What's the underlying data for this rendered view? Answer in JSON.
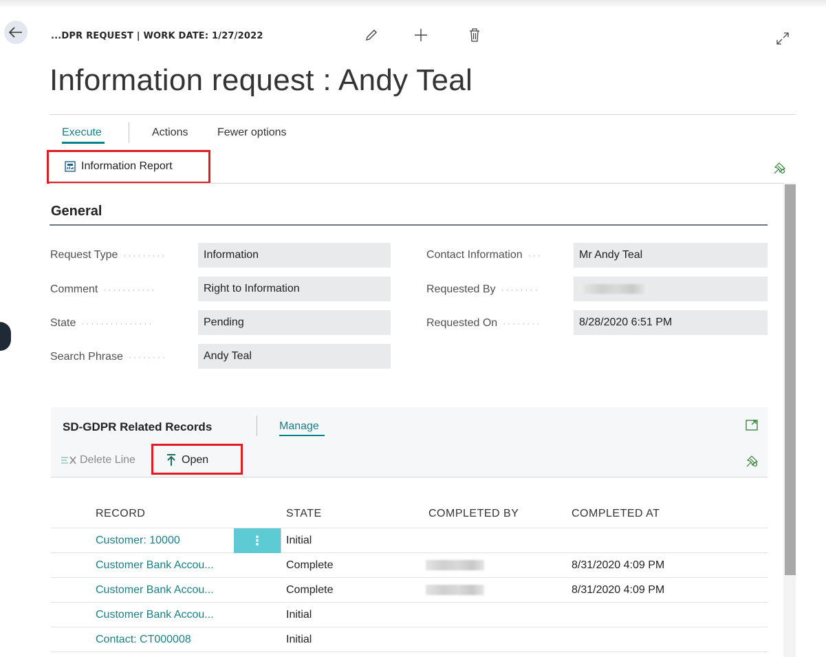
{
  "header": {
    "breadcrumb": "...DPR REQUEST | WORK DATE: 1/27/2022",
    "title": "Information request : Andy Teal"
  },
  "tabs": [
    {
      "label": "Execute",
      "active": true
    },
    {
      "label": "Actions"
    },
    {
      "label": "Fewer options"
    }
  ],
  "actions": {
    "information_report": "Information Report"
  },
  "general": {
    "section_title": "General",
    "left_fields": [
      {
        "label": "Request Type",
        "value": "Information"
      },
      {
        "label": "Comment",
        "value": "Right to Information"
      },
      {
        "label": "State",
        "value": "Pending"
      },
      {
        "label": "Search Phrase",
        "value": "Andy Teal"
      }
    ],
    "right_fields": [
      {
        "label": "Contact Information",
        "value": "Mr Andy Teal"
      },
      {
        "label": "Requested By",
        "value": ""
      },
      {
        "label": "Requested On",
        "value": "8/28/2020 6:51 PM"
      }
    ]
  },
  "related": {
    "title": "SD-GDPR Related Records",
    "manage": "Manage",
    "delete_line": "Delete Line",
    "open": "Open",
    "columns": [
      "RECORD",
      "STATE",
      "COMPLETED BY",
      "COMPLETED AT"
    ],
    "rows": [
      {
        "record": "Customer: 10000",
        "state": "Initial",
        "completed_by": "",
        "completed_at": ""
      },
      {
        "record": "Customer Bank Accou...",
        "state": "Complete",
        "completed_by": "",
        "completed_at": "8/31/2020 4:09 PM"
      },
      {
        "record": "Customer Bank Accou...",
        "state": "Complete",
        "completed_by": "",
        "completed_at": "8/31/2020 4:09 PM"
      },
      {
        "record": "Customer Bank Accou...",
        "state": "Initial",
        "completed_by": "",
        "completed_at": ""
      },
      {
        "record": "Contact: CT000008",
        "state": "Initial",
        "completed_by": "",
        "completed_at": ""
      }
    ]
  },
  "colors": {
    "accent": "#00838a",
    "highlight": "#e01b24",
    "field_bg": "#e9eaec"
  },
  "icons": [
    "back-arrow-icon",
    "edit-pencil-icon",
    "plus-icon",
    "trash-icon",
    "expand-icon",
    "report-icon",
    "pin-icon",
    "delete-line-icon",
    "open-arrow-icon",
    "fullscreen-icon",
    "more-dots-icon"
  ]
}
